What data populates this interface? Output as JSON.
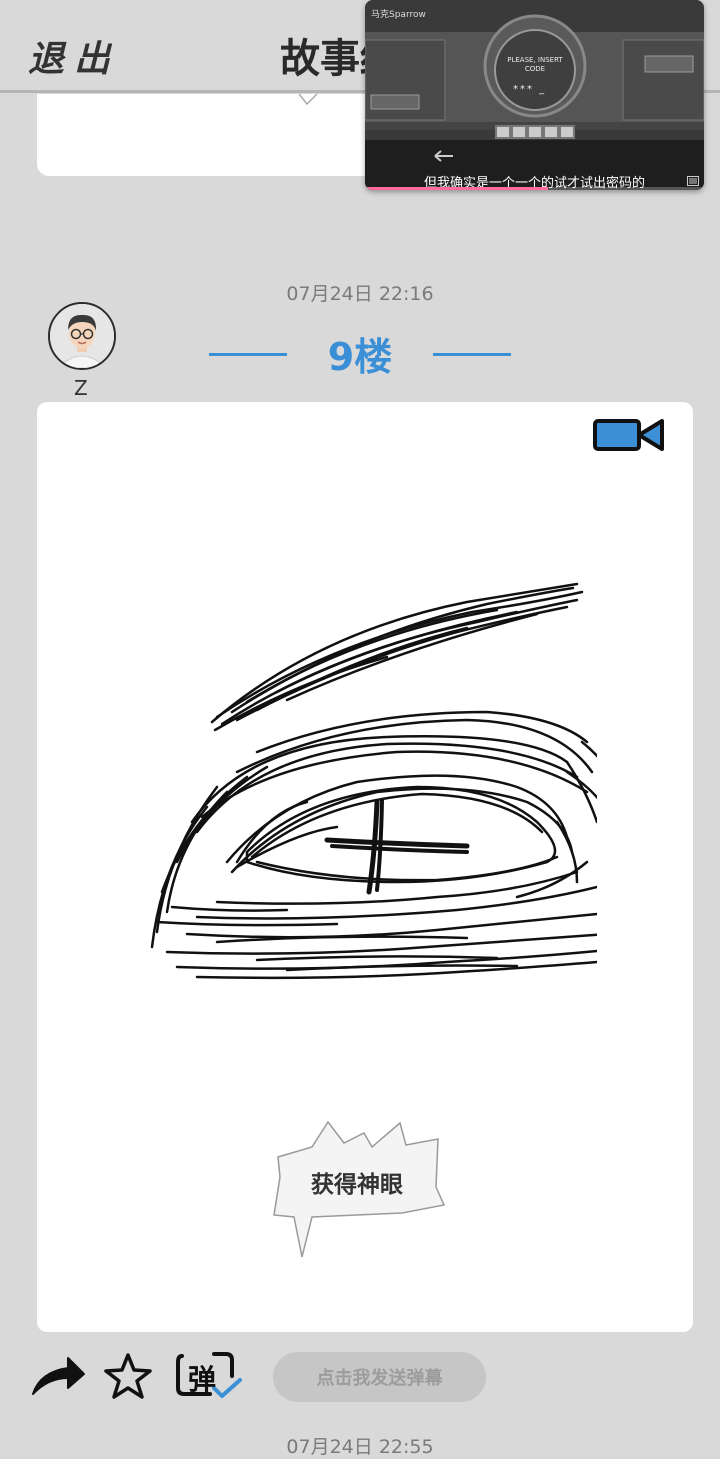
{
  "header": {
    "exit_label": "退出",
    "title": "故事结"
  },
  "video_overlay": {
    "channel": "马克Sparrow",
    "screen_prompt": "PLEASE, INSERT CODE",
    "code_display": "*** _",
    "subtitle": "但我确实是一个一个的试才试出密码的",
    "progress": 0.54
  },
  "post": {
    "date": "07月24日  22:16",
    "floor": "9楼",
    "author": "Z",
    "speech_bubble": "获得神眼"
  },
  "actions": {
    "danmaku_placeholder": "点击我发送弹幕",
    "danmaku_icon_char": "弹"
  },
  "next_post": {
    "date": "07月24日  22:55"
  },
  "colors": {
    "accent": "#3b8fd6",
    "background": "#d9d9d9",
    "card": "#ffffff",
    "progress": "#ff6b9a"
  }
}
